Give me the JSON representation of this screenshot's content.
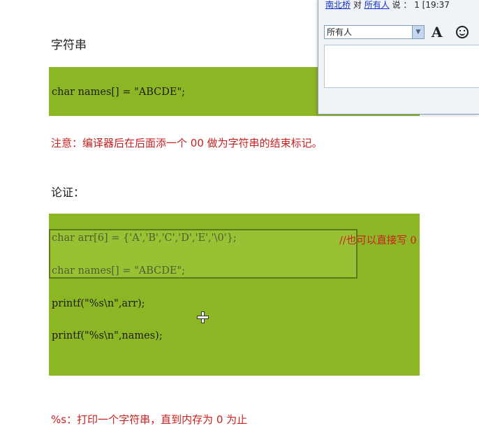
{
  "doc": {
    "heading": "字符串",
    "box1_line": "char names[] = \"ABCDE\";",
    "note": "注意：编译器后在后面添一个 00 做为字符串的结束标记。",
    "heading2": "论证：",
    "box2_lines": [
      "char arr[6] = {'A','B','C','D','E','\\0'};",
      "char names[] = \"ABCDE\";",
      "printf(\"%s\\n\",arr);",
      "printf(\"%s\\n\",names);"
    ],
    "comment": "//也可以直接写 0",
    "footer": "%s：打印一个字符串，直到内存为 0 为止",
    "code_bg": "#8db625",
    "note_color": "#c81f1f"
  },
  "chat": {
    "sender": "南北桥",
    "to_word": "对",
    "recipient": "所有人",
    "says_word": "说 ：",
    "count": "1",
    "time": "[19:37",
    "select_value": "所有人",
    "font_icon": "A",
    "icons": [
      "font-icon",
      "smiley-icon",
      "chevron-down-icon"
    ]
  }
}
